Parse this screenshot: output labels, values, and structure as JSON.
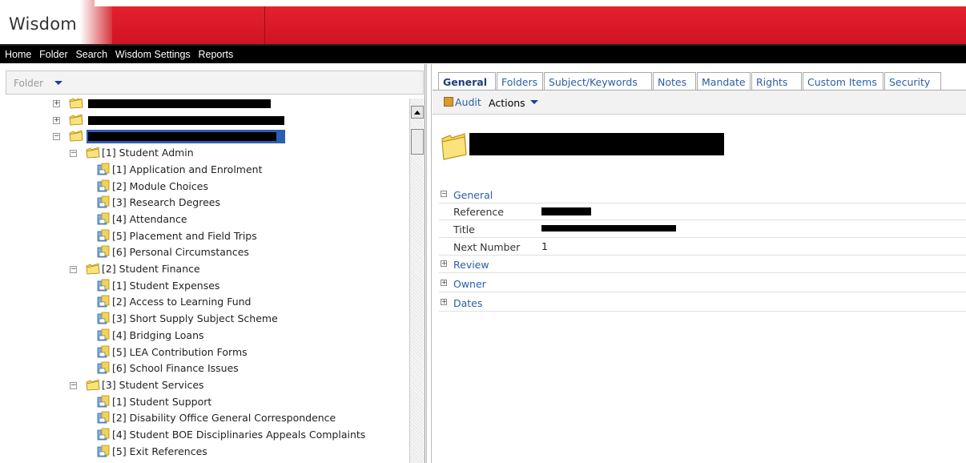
{
  "app": {
    "logo": "Wisdom"
  },
  "menu": [
    "Home",
    "Folder",
    "Search",
    "Wisdom Settings",
    "Reports"
  ],
  "left_pane": {
    "folder_label": "Folder",
    "tree": [
      {
        "type": "folder",
        "level": 0,
        "expander": "+",
        "text": "",
        "redacted": true
      },
      {
        "type": "folder",
        "level": 0,
        "expander": "+",
        "text": "",
        "redacted": true
      },
      {
        "type": "folder",
        "level": 0,
        "expander": "−",
        "text": "",
        "redacted": true,
        "selected": true
      },
      {
        "type": "folder",
        "level": 1,
        "expander": "−",
        "text": "[1] Student Admin"
      },
      {
        "type": "doc",
        "level": 2,
        "text": "[1] Application and Enrolment"
      },
      {
        "type": "doc",
        "level": 2,
        "text": "[2] Module Choices"
      },
      {
        "type": "doc",
        "level": 2,
        "text": "[3] Research Degrees"
      },
      {
        "type": "doc",
        "level": 2,
        "text": "[4] Attendance"
      },
      {
        "type": "doc",
        "level": 2,
        "text": "[5] Placement and Field Trips"
      },
      {
        "type": "doc",
        "level": 2,
        "text": "[6] Personal Circumstances"
      },
      {
        "type": "folder",
        "level": 1,
        "expander": "−",
        "text": "[2] Student Finance"
      },
      {
        "type": "doc",
        "level": 2,
        "text": "[1] Student Expenses"
      },
      {
        "type": "doc",
        "level": 2,
        "text": "[2] Access to Learning Fund"
      },
      {
        "type": "doc",
        "level": 2,
        "text": "[3] Short Supply Subject Scheme"
      },
      {
        "type": "doc",
        "level": 2,
        "text": "[4] Bridging Loans"
      },
      {
        "type": "doc",
        "level": 2,
        "text": "[5] LEA Contribution Forms"
      },
      {
        "type": "doc",
        "level": 2,
        "text": "[6] School Finance Issues"
      },
      {
        "type": "folder",
        "level": 1,
        "expander": "−",
        "text": "[3] Student Services"
      },
      {
        "type": "doc",
        "level": 2,
        "text": "[1] Student Support"
      },
      {
        "type": "doc",
        "level": 2,
        "text": "[2] Disability Office General Correspondence"
      },
      {
        "type": "doc",
        "level": 2,
        "text": "[4] Student BOE Disciplinaries Appeals Complaints"
      },
      {
        "type": "doc",
        "level": 2,
        "text": "[5] Exit References"
      }
    ]
  },
  "right_pane": {
    "tabs": [
      "General",
      "Folders",
      "Subject/Keywords",
      "Notes",
      "Mandate",
      "Rights",
      "Custom Items",
      "Security"
    ],
    "active_tab": "General",
    "toolbar": {
      "audit": "Audit",
      "actions": "Actions"
    },
    "sections": {
      "general": {
        "label": "General",
        "expander": "−"
      },
      "review": {
        "label": "Review",
        "expander": "+"
      },
      "owner": {
        "label": "Owner",
        "expander": "+"
      },
      "dates": {
        "label": "Dates",
        "expander": "+"
      }
    },
    "properties": {
      "reference_label": "Reference",
      "title_label": "Title",
      "next_number_label": "Next Number",
      "next_number_value": "1"
    }
  },
  "colors": {
    "brand_red": "#d81d2a",
    "link_blue": "#2b5da8",
    "selection_blue": "#2c5fb3",
    "folder_yellow": "#f2d45a"
  }
}
